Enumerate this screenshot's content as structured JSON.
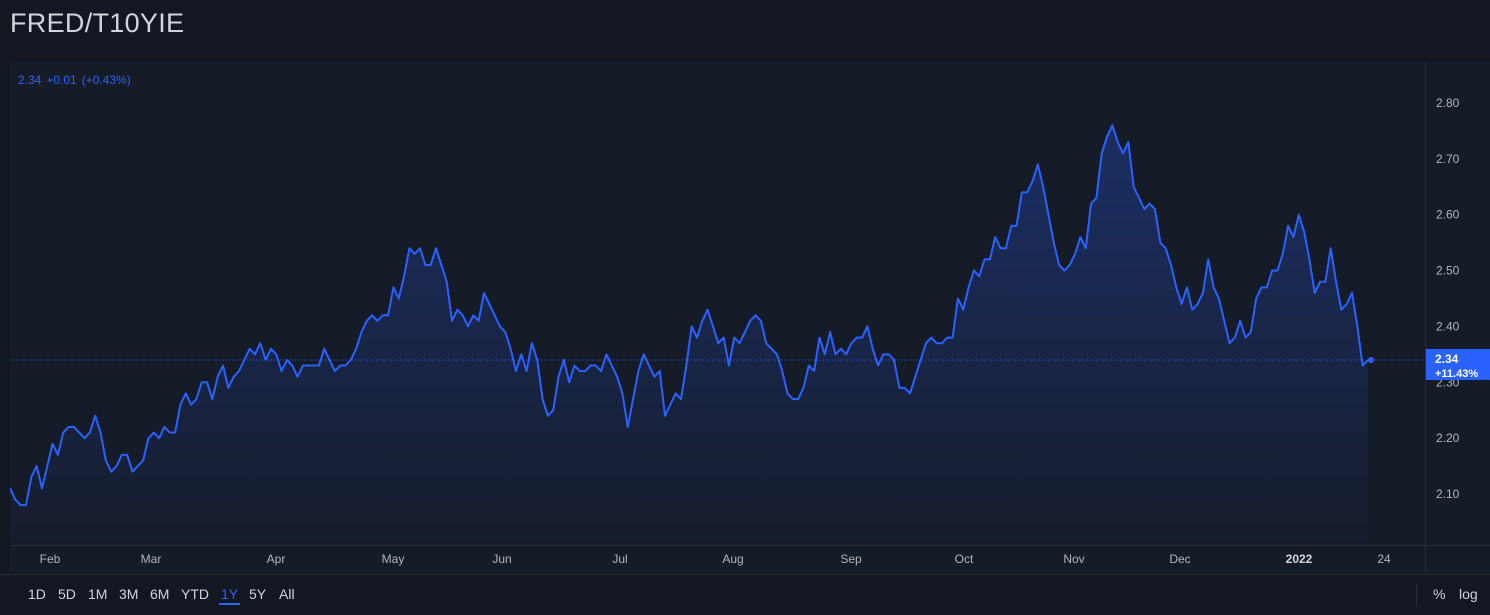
{
  "header": {
    "title": "FRED/T10YIE"
  },
  "legend": {
    "value": "2.34",
    "change": "+0.01",
    "change_pct": "(+0.43%)"
  },
  "price_label": {
    "value": "2.34",
    "change_pct": "+11.43%"
  },
  "colors": {
    "line": "#2962ff",
    "background": "#161b28",
    "text": "#d1d4dc"
  },
  "toolbar": {
    "ranges": [
      "1D",
      "5D",
      "1M",
      "3M",
      "6M",
      "YTD",
      "1Y",
      "5Y",
      "All"
    ],
    "active_range": "1Y",
    "percent_label": "%",
    "log_label": "log"
  },
  "chart_data": {
    "type": "area",
    "x_tick_labels": [
      "Feb",
      "Mar",
      "Apr",
      "May",
      "Jun",
      "Jul",
      "Aug",
      "Sep",
      "Oct",
      "Nov",
      "Dec",
      "2022",
      "24"
    ],
    "y_ticks": [
      2.1,
      2.2,
      2.3,
      2.4,
      2.5,
      2.6,
      2.7,
      2.8
    ],
    "ylim": [
      2.02,
      2.87
    ],
    "last_value": 2.34,
    "values": [
      2.11,
      2.09,
      2.08,
      2.08,
      2.13,
      2.15,
      2.11,
      2.15,
      2.19,
      2.17,
      2.21,
      2.22,
      2.22,
      2.21,
      2.2,
      2.21,
      2.24,
      2.21,
      2.16,
      2.14,
      2.15,
      2.17,
      2.17,
      2.14,
      2.15,
      2.16,
      2.2,
      2.21,
      2.2,
      2.22,
      2.21,
      2.21,
      2.26,
      2.28,
      2.26,
      2.27,
      2.3,
      2.3,
      2.27,
      2.31,
      2.33,
      2.29,
      2.31,
      2.32,
      2.34,
      2.36,
      2.35,
      2.37,
      2.34,
      2.36,
      2.35,
      2.32,
      2.34,
      2.33,
      2.31,
      2.33,
      2.33,
      2.33,
      2.33,
      2.36,
      2.34,
      2.32,
      2.33,
      2.33,
      2.34,
      2.36,
      2.39,
      2.41,
      2.42,
      2.41,
      2.42,
      2.42,
      2.47,
      2.45,
      2.49,
      2.54,
      2.53,
      2.54,
      2.51,
      2.51,
      2.54,
      2.51,
      2.48,
      2.41,
      2.43,
      2.42,
      2.4,
      2.42,
      2.41,
      2.46,
      2.44,
      2.42,
      2.4,
      2.39,
      2.36,
      2.32,
      2.35,
      2.32,
      2.37,
      2.34,
      2.27,
      2.24,
      2.25,
      2.31,
      2.34,
      2.3,
      2.33,
      2.32,
      2.32,
      2.33,
      2.33,
      2.32,
      2.35,
      2.33,
      2.31,
      2.28,
      2.22,
      2.27,
      2.32,
      2.35,
      2.33,
      2.31,
      2.32,
      2.24,
      2.26,
      2.28,
      2.27,
      2.33,
      2.4,
      2.38,
      2.41,
      2.43,
      2.4,
      2.37,
      2.38,
      2.33,
      2.38,
      2.37,
      2.39,
      2.41,
      2.42,
      2.41,
      2.37,
      2.36,
      2.35,
      2.32,
      2.28,
      2.27,
      2.27,
      2.29,
      2.33,
      2.32,
      2.38,
      2.35,
      2.39,
      2.35,
      2.36,
      2.35,
      2.37,
      2.38,
      2.38,
      2.4,
      2.36,
      2.33,
      2.35,
      2.35,
      2.34,
      2.29,
      2.29,
      2.28,
      2.31,
      2.34,
      2.37,
      2.38,
      2.37,
      2.37,
      2.38,
      2.38,
      2.45,
      2.43,
      2.47,
      2.5,
      2.49,
      2.52,
      2.52,
      2.56,
      2.54,
      2.54,
      2.58,
      2.58,
      2.64,
      2.64,
      2.66,
      2.69,
      2.65,
      2.6,
      2.55,
      2.51,
      2.5,
      2.51,
      2.53,
      2.56,
      2.54,
      2.62,
      2.63,
      2.71,
      2.74,
      2.76,
      2.73,
      2.71,
      2.73,
      2.65,
      2.63,
      2.61,
      2.62,
      2.61,
      2.55,
      2.54,
      2.51,
      2.47,
      2.44,
      2.47,
      2.43,
      2.44,
      2.46,
      2.52,
      2.47,
      2.45,
      2.41,
      2.37,
      2.38,
      2.41,
      2.38,
      2.39,
      2.45,
      2.47,
      2.47,
      2.5,
      2.5,
      2.53,
      2.58,
      2.56,
      2.6,
      2.57,
      2.52,
      2.46,
      2.48,
      2.48,
      2.54,
      2.48,
      2.43,
      2.44,
      2.46,
      2.4,
      2.33,
      2.34
    ]
  }
}
